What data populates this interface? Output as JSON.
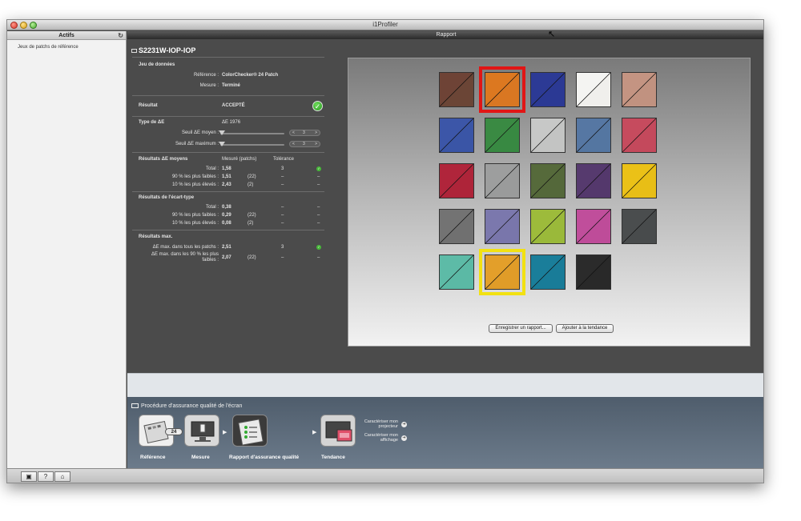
{
  "window": {
    "title": "i1Profiler"
  },
  "sidebar": {
    "header": "Actifs",
    "refresh_icon": "refresh-icon",
    "item": "Jeux de patchs de référence"
  },
  "rapport": {
    "title": "Rapport"
  },
  "device": {
    "name": "S2231W-IOP-IOP"
  },
  "dataset": {
    "heading": "Jeu de données",
    "reference_label": "Référence :",
    "reference_value": "ColorChecker® 24 Patch",
    "measure_label": "Mesure :",
    "measure_value": "Terminé"
  },
  "result": {
    "label": "Résultat",
    "value": "ACCEPTÉ",
    "status": "pass"
  },
  "delta_type": {
    "label": "Type de ΔE",
    "value": "ΔE 1976",
    "avg_threshold_label": "Seuil ΔE moyen :",
    "avg_threshold_value": "3",
    "max_threshold_label": "Seuil ΔE maximum :",
    "max_threshold_value": "3"
  },
  "mean_results": {
    "heading": "Résultats ΔE moyens",
    "col_measured": "Mesuré (patchs)",
    "col_tolerance": "Tolérance",
    "rows": [
      {
        "label": "Total :",
        "value": "1,58",
        "patches": "",
        "tolerance": "3",
        "status": "pass"
      },
      {
        "label": "90 % les plus faibles :",
        "value": "1,51",
        "patches": "(22)",
        "tolerance": "–",
        "status": "–"
      },
      {
        "label": "10 % les plus élevés :",
        "value": "2,43",
        "patches": "(2)",
        "tolerance": "–",
        "status": "–"
      }
    ]
  },
  "std_results": {
    "heading": "Résultats de l'écart-type",
    "rows": [
      {
        "label": "Total :",
        "value": "0,38",
        "patches": "",
        "tolerance": "–",
        "status": "–"
      },
      {
        "label": "90 % les plus faibles :",
        "value": "0,29",
        "patches": "(22)",
        "tolerance": "–",
        "status": "–"
      },
      {
        "label": "10 % les plus élevés :",
        "value": "0,08",
        "patches": "(2)",
        "tolerance": "–",
        "status": "–"
      }
    ]
  },
  "max_results": {
    "heading": "Résultats max.",
    "rows": [
      {
        "label": "ΔE max. dans tous les patchs :",
        "value": "2,51",
        "patches": "",
        "tolerance": "3",
        "status": "pass"
      },
      {
        "label": "ΔE max. dans les 90 % les plus faibles :",
        "value": "2,07",
        "patches": "(22)",
        "tolerance": "–",
        "status": "–"
      }
    ]
  },
  "patches": [
    {
      "top": "#6e4336",
      "bottom": "#6b4536",
      "highlight": ""
    },
    {
      "top": "#dc7820",
      "bottom": "#d97722",
      "highlight": "red"
    },
    {
      "top": "#2c3a95",
      "bottom": "#2b3994",
      "highlight": ""
    },
    {
      "top": "#f4f4f2",
      "bottom": "#f0efec",
      "highlight": ""
    },
    {
      "top": "#c49482",
      "bottom": "#c19280",
      "highlight": ""
    },
    {
      "top": "#3c56a8",
      "bottom": "#3a55a6",
      "highlight": ""
    },
    {
      "top": "#3a8a43",
      "bottom": "#388942",
      "highlight": ""
    },
    {
      "top": "#c7c8c7",
      "bottom": "#c3c4c3",
      "highlight": ""
    },
    {
      "top": "#5677a3",
      "bottom": "#5476a1",
      "highlight": ""
    },
    {
      "top": "#c64b5e",
      "bottom": "#c4495c",
      "highlight": ""
    },
    {
      "top": "#b0253b",
      "bottom": "#ae2439",
      "highlight": ""
    },
    {
      "top": "#9d9e9e",
      "bottom": "#9a9b9b",
      "highlight": ""
    },
    {
      "top": "#566a3b",
      "bottom": "#54683a",
      "highlight": ""
    },
    {
      "top": "#563a6e",
      "bottom": "#54386c",
      "highlight": ""
    },
    {
      "top": "#ebc117",
      "bottom": "#e8be16",
      "highlight": ""
    },
    {
      "top": "#737373",
      "bottom": "#707070",
      "highlight": ""
    },
    {
      "top": "#7b78ad",
      "bottom": "#7976ab",
      "highlight": ""
    },
    {
      "top": "#9dbb3b",
      "bottom": "#9ab93a",
      "highlight": ""
    },
    {
      "top": "#c04e9b",
      "bottom": "#be4c99",
      "highlight": ""
    },
    {
      "top": "#4a4d4e",
      "bottom": "#484b4c",
      "highlight": ""
    },
    {
      "top": "#5dbba7",
      "bottom": "#5bb9a5",
      "highlight": ""
    },
    {
      "top": "#e39f2a",
      "bottom": "#e09c28",
      "highlight": "yellow"
    },
    {
      "top": "#1a7e9a",
      "bottom": "#197c98",
      "highlight": ""
    },
    {
      "top": "#2b2b2b",
      "bottom": "#292929",
      "highlight": ""
    }
  ],
  "buttons": {
    "save_report": "Enregistrer un rapport...",
    "add_trend": "Ajouter à la tendance"
  },
  "workflow": {
    "title": "Procédure d'assurance qualité de l'écran",
    "badge": "24",
    "steps": [
      "Référence",
      "Mesure",
      "Rapport d'assurance qualité",
      "Tendance"
    ],
    "link_projector": "Caractériser mon projecteur",
    "link_display": "Caractériser mon affichage"
  },
  "bottom": {
    "fullscreen_icon": "fullscreen-icon",
    "help_label": "?",
    "home_icon": "home-icon"
  }
}
